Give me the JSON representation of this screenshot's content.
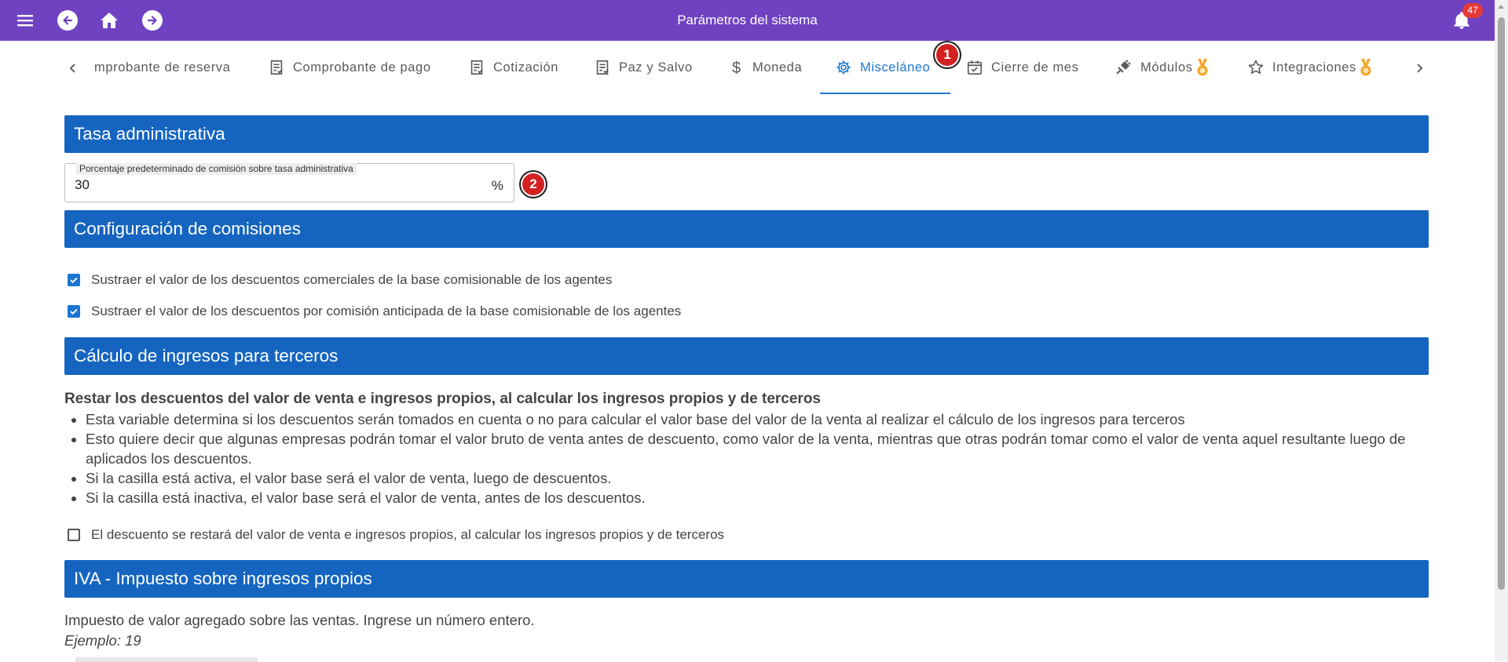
{
  "app": {
    "title": "Parámetros del sistema",
    "notification_count": "47"
  },
  "topbar": {
    "icons": [
      "menu-icon",
      "back-icon",
      "home-icon",
      "forward-icon",
      "bell-icon"
    ]
  },
  "tabs": [
    {
      "label": "mprobante de reserva",
      "icon": "receipt-icon"
    },
    {
      "label": "Comprobante de pago",
      "icon": "receipt-icon"
    },
    {
      "label": "Cotización",
      "icon": "receipt-icon"
    },
    {
      "label": "Paz y Salvo",
      "icon": "receipt-icon"
    },
    {
      "label": "Moneda",
      "icon": "dollar-icon"
    },
    {
      "label": "Misceláneo",
      "icon": "gear-icon",
      "active": true
    },
    {
      "label": "Cierre de mes",
      "icon": "calendar-check-icon"
    },
    {
      "label": "Módulos",
      "icon": "plug-icon",
      "badge": "medal-icon"
    },
    {
      "label": "Integraciones",
      "icon": "star-icon",
      "badge": "medal-icon"
    }
  ],
  "callouts": {
    "one": "1",
    "two": "2"
  },
  "sections": {
    "tasa": "Tasa administrativa",
    "comisiones": "Configuración de comisiones",
    "terceros": "Cálculo de ingresos para terceros",
    "iva": "IVA - Impuesto sobre ingresos propios"
  },
  "tasa_field": {
    "label": "Porcentaje predeterminado de comisión sobre tasa administrativa",
    "value": "30",
    "suffix": "%"
  },
  "comisiones_options": [
    {
      "label": "Sustraer el valor de los descuentos comerciales de la base comisionable de los agentes",
      "checked": true
    },
    {
      "label": "Sustraer el valor de los descuentos por comisión anticipada de la base comisionable de los agentes",
      "checked": true
    }
  ],
  "terceros": {
    "title": "Restar los descuentos del valor de venta e ingresos propios, al calcular los ingresos propios y de terceros",
    "bullets": [
      "Esta variable determina si los descuentos serán tomados en cuenta o no para calcular el valor base del valor de la venta al realizar el cálculo de los ingresos para terceros",
      "Esto quiere decir que algunas empresas podrán tomar el valor bruto de venta antes de descuento, como valor de la venta, mientras que otras podrán tomar como el valor de venta aquel resultante luego de aplicados los descuentos.",
      "Si la casilla está activa, el valor base será el valor de venta, luego de descuentos.",
      "Si la casilla está inactiva, el valor base será el valor de venta, antes de los descuentos."
    ],
    "checkbox_label": "El descuento se restará del valor de venta e ingresos propios, al calcular los ingresos propios y de terceros",
    "checkbox_checked": false
  },
  "iva": {
    "description": "Impuesto de valor agregado sobre las ventas. Ingrese un número entero.",
    "example": "Ejemplo: 19"
  },
  "colors": {
    "topbar": "#6f42c1",
    "section_header": "#1565c0",
    "active_tab": "#1e78d0",
    "callout": "#d32020",
    "badge": "#e53935",
    "medal": "#f5a623"
  }
}
